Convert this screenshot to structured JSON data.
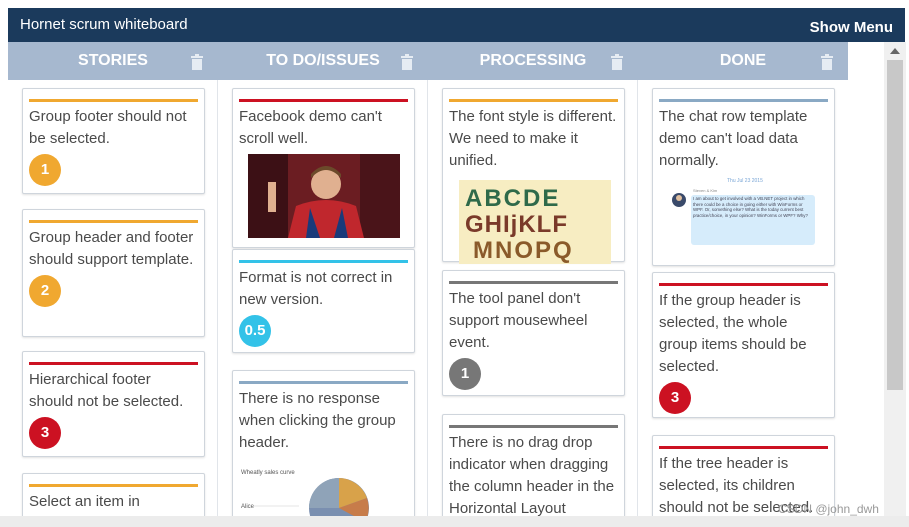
{
  "app": {
    "title": "Hornet scrum whiteboard",
    "menu_label": "Show Menu"
  },
  "columns": [
    {
      "header": "STORIES"
    },
    {
      "header": "TO DO/ISSUES"
    },
    {
      "header": "PROCESSING"
    },
    {
      "header": "DONE"
    }
  ],
  "cards": {
    "stories": [
      {
        "text": "Group footer should not be selected.",
        "badge": "1",
        "bar_color": "#f0a830",
        "badge_color": "#f0a830"
      },
      {
        "text": "Group header and footer should support template.",
        "badge": "2",
        "bar_color": "#f0a830",
        "badge_color": "#f0a830"
      },
      {
        "text": "Hierarchical footer should not be selected.",
        "badge": "3",
        "bar_color": "#cc1122",
        "badge_color": "#cc1122"
      },
      {
        "text": "Select an item in",
        "bar_color": "#f0a830"
      }
    ],
    "todo": [
      {
        "text": "Facebook demo can't scroll well.",
        "bar_color": "#cc1122"
      },
      {
        "text": "Format is not correct in new version.",
        "badge": "0.5",
        "bar_color": "#33c2e8",
        "badge_color": "#33c2e8"
      },
      {
        "text": "There is no response when clicking the group header.",
        "bar_color": "#8aa9c4",
        "pie_title": "Wheatly sales curve",
        "pie_label": "Alice"
      }
    ],
    "processing": [
      {
        "text": "The font style is different. We need to make it unified.",
        "bar_color": "#f0a830",
        "font_sample_line1": "ABCDE",
        "font_sample_line2": "GHIjKLF",
        "font_sample_line3": "MNOPQ"
      },
      {
        "text": "The tool panel don't support mousewheel event.",
        "badge": "1",
        "bar_color": "#777777",
        "badge_color": "#777777"
      },
      {
        "text": "There is no drag drop indicator when dragging the column header in the Horizontal Layout",
        "bar_color": "#777777"
      }
    ],
    "done": [
      {
        "text": "The chat row template demo can't load data normally.",
        "bar_color": "#8aa9c4",
        "chat_date": "Thu Jul 23 2015",
        "chat_sender": "Steven & Kim",
        "chat_message": "I am about to get involved with a VB.NET project in which there could be a choice in going either with WinForms or WPF. Or, something else? What is the today current best practice/choice, in your opinion? WinForms or WPF? Why?"
      },
      {
        "text": "If the group header is selected, the whole group items should be selected.",
        "badge": "3",
        "bar_color": "#cc1122",
        "badge_color": "#cc1122"
      },
      {
        "text": "If the tree header is selected, its children should not be selected.",
        "bar_color": "#cc1122"
      }
    ]
  },
  "watermark": "CSDN @john_dwh"
}
